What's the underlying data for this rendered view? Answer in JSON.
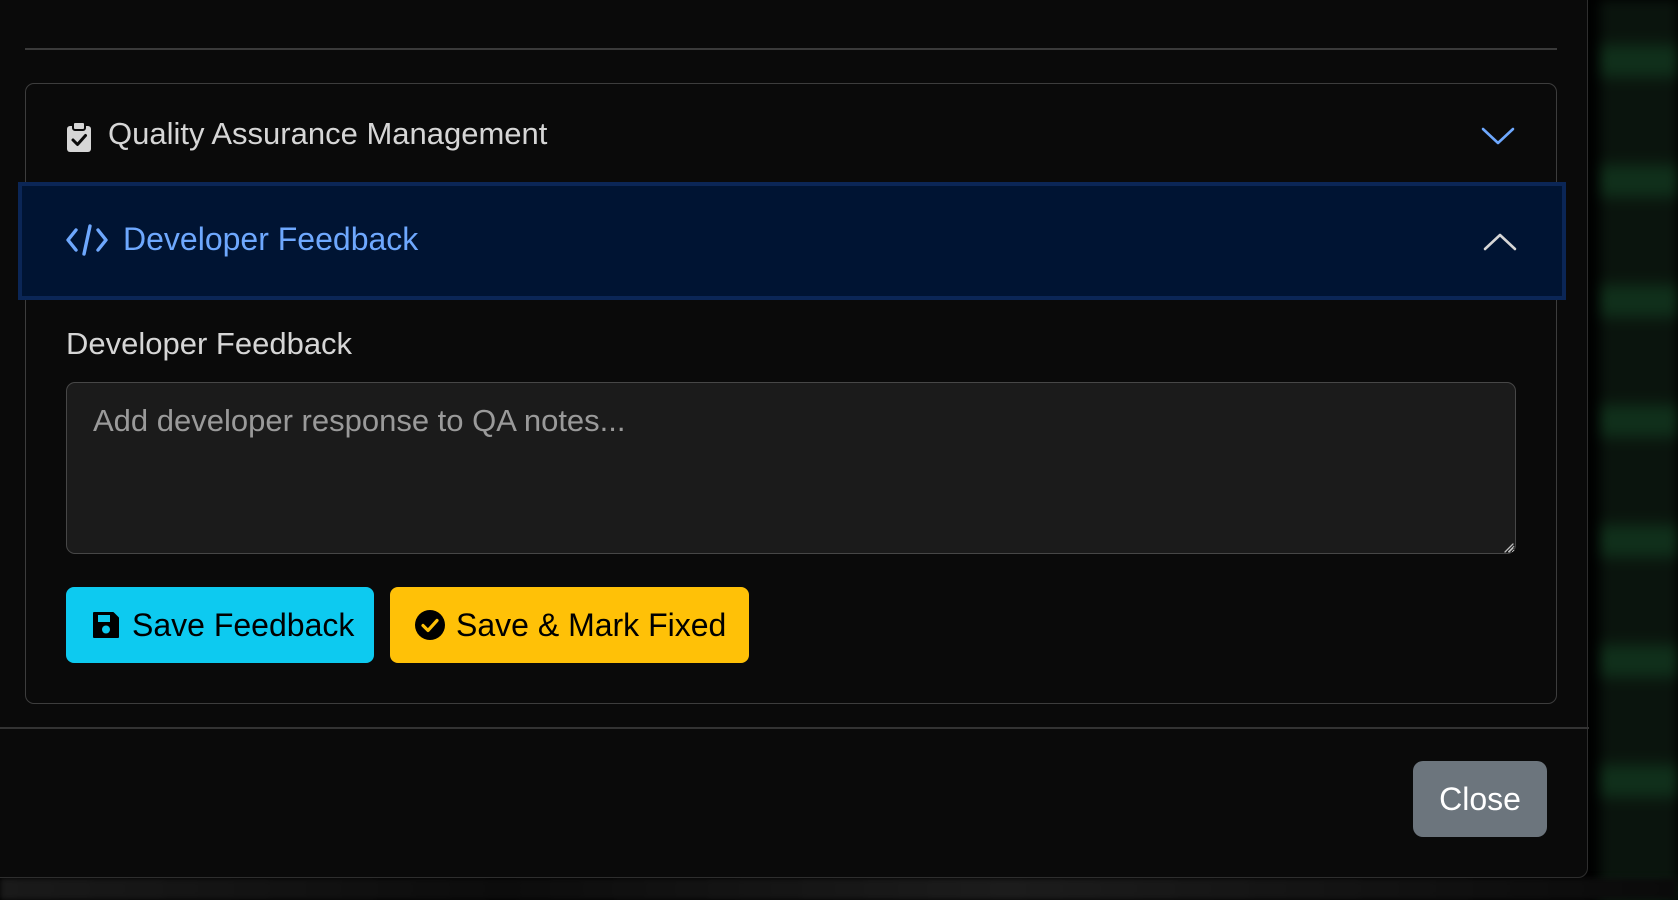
{
  "accordion": {
    "qa_section": {
      "title": "Quality Assurance Management",
      "icon": "clipboard-check-icon",
      "expanded": false
    },
    "dev_section": {
      "title": "Developer Feedback",
      "icon": "code-icon",
      "expanded": true,
      "field_label": "Developer Feedback",
      "textarea_value": "",
      "textarea_placeholder": "Add developer response to QA notes..."
    }
  },
  "actions": {
    "save_feedback": {
      "label": "Save Feedback",
      "icon": "floppy-disk-icon",
      "color": "#0dcaf0"
    },
    "save_mark_fixed": {
      "label": "Save & Mark Fixed",
      "icon": "check-circle-icon",
      "color": "#ffc107"
    }
  },
  "footer": {
    "close_label": "Close",
    "close_color": "#6c757d"
  },
  "colors": {
    "accent": "#6ea8fe",
    "active_header_bg": "#001433",
    "modal_bg": "#0a0a0a"
  }
}
